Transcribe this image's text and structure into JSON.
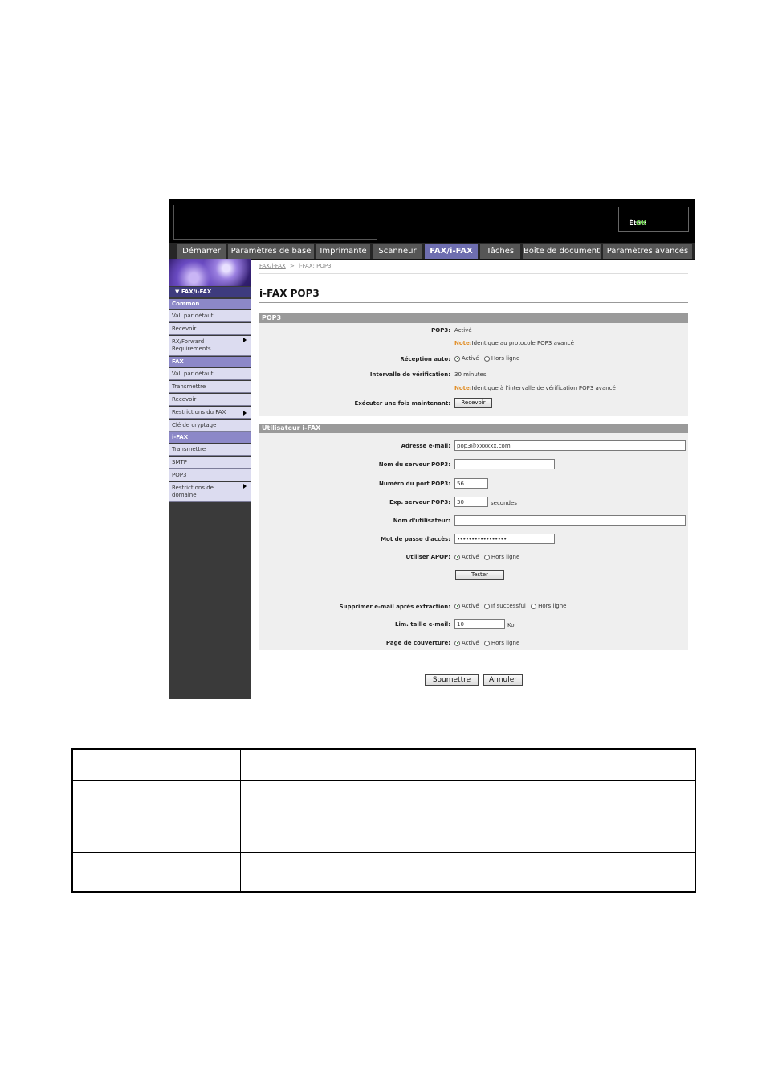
{
  "status": {
    "label": "État:",
    "value": "OK"
  },
  "nav_tabs": [
    {
      "label": "Démarrer",
      "active": false
    },
    {
      "label": "Paramètres de base",
      "active": false
    },
    {
      "label": "Imprimante",
      "active": false
    },
    {
      "label": "Scanneur",
      "active": false
    },
    {
      "label": "FAX/i-FAX",
      "active": true
    },
    {
      "label": "Tâches",
      "active": false
    },
    {
      "label": "Boîte de document",
      "active": false
    },
    {
      "label": "Paramètres avancés",
      "active": false
    }
  ],
  "sidebar": {
    "header": "▼ FAX/i-FAX",
    "groups": {
      "common": "Common",
      "fax": "FAX",
      "ifax": "i-FAX"
    },
    "common_items": [
      "Val. par défaut",
      "Recevoir",
      "RX/Forward Requirements"
    ],
    "fax_items": [
      "Val. par défaut",
      "Transmettre",
      "Recevoir",
      "Restrictions du FAX",
      "Clé de cryptage"
    ],
    "ifax_items": [
      "Transmettre",
      "SMTP",
      "POP3",
      "Restrictions de domaine"
    ]
  },
  "breadcrumb": {
    "link": "FAX/i-FAX",
    "separator": ">",
    "current": "i-FAX: POP3"
  },
  "page_title": "i-FAX POP3",
  "pop3_section": {
    "title": "POP3",
    "pop3_label": "POP3:",
    "pop3_value": "Activé",
    "note_prefix": "Note:",
    "note1": "Identique au protocole POP3 avancé",
    "reception_label": "Réception auto:",
    "reception_options": [
      "Activé",
      "Hors ligne"
    ],
    "interval_label": "Intervalle de vérification:",
    "interval_value": "30 minutes",
    "note2": "Identique à l'intervalle de vérification POP3 avancé",
    "run_label": "Exécuter une fois maintenant:",
    "run_button": "Recevoir"
  },
  "user_section": {
    "title": "Utilisateur i-FAX",
    "email_label": "Adresse e-mail:",
    "email_value": "pop3@xxxxxx.com",
    "server_label": "Nom du serveur POP3:",
    "server_value": "",
    "port_label": "Numéro du port POP3:",
    "port_value": "56",
    "timeout_label": "Exp. serveur POP3:",
    "timeout_value": "30",
    "timeout_unit": "secondes",
    "username_label": "Nom d'utilisateur:",
    "username_value": "",
    "password_label": "Mot de passe d'accès:",
    "password_value": "•••••••••••••••••",
    "apop_label": "Utiliser APOP:",
    "apop_options": [
      "Activé",
      "Hors ligne"
    ],
    "test_button": "Tester",
    "delete_label": "Supprimer e-mail après extraction:",
    "delete_options": [
      "Activé",
      "If successful",
      "Hors ligne"
    ],
    "size_label": "Lim. taille e-mail:",
    "size_value": "10",
    "size_unit": "Ko",
    "cover_label": "Page de couverture:",
    "cover_options": [
      "Activé",
      "Hors ligne"
    ]
  },
  "buttons": {
    "submit": "Soumettre",
    "cancel": "Annuler"
  }
}
